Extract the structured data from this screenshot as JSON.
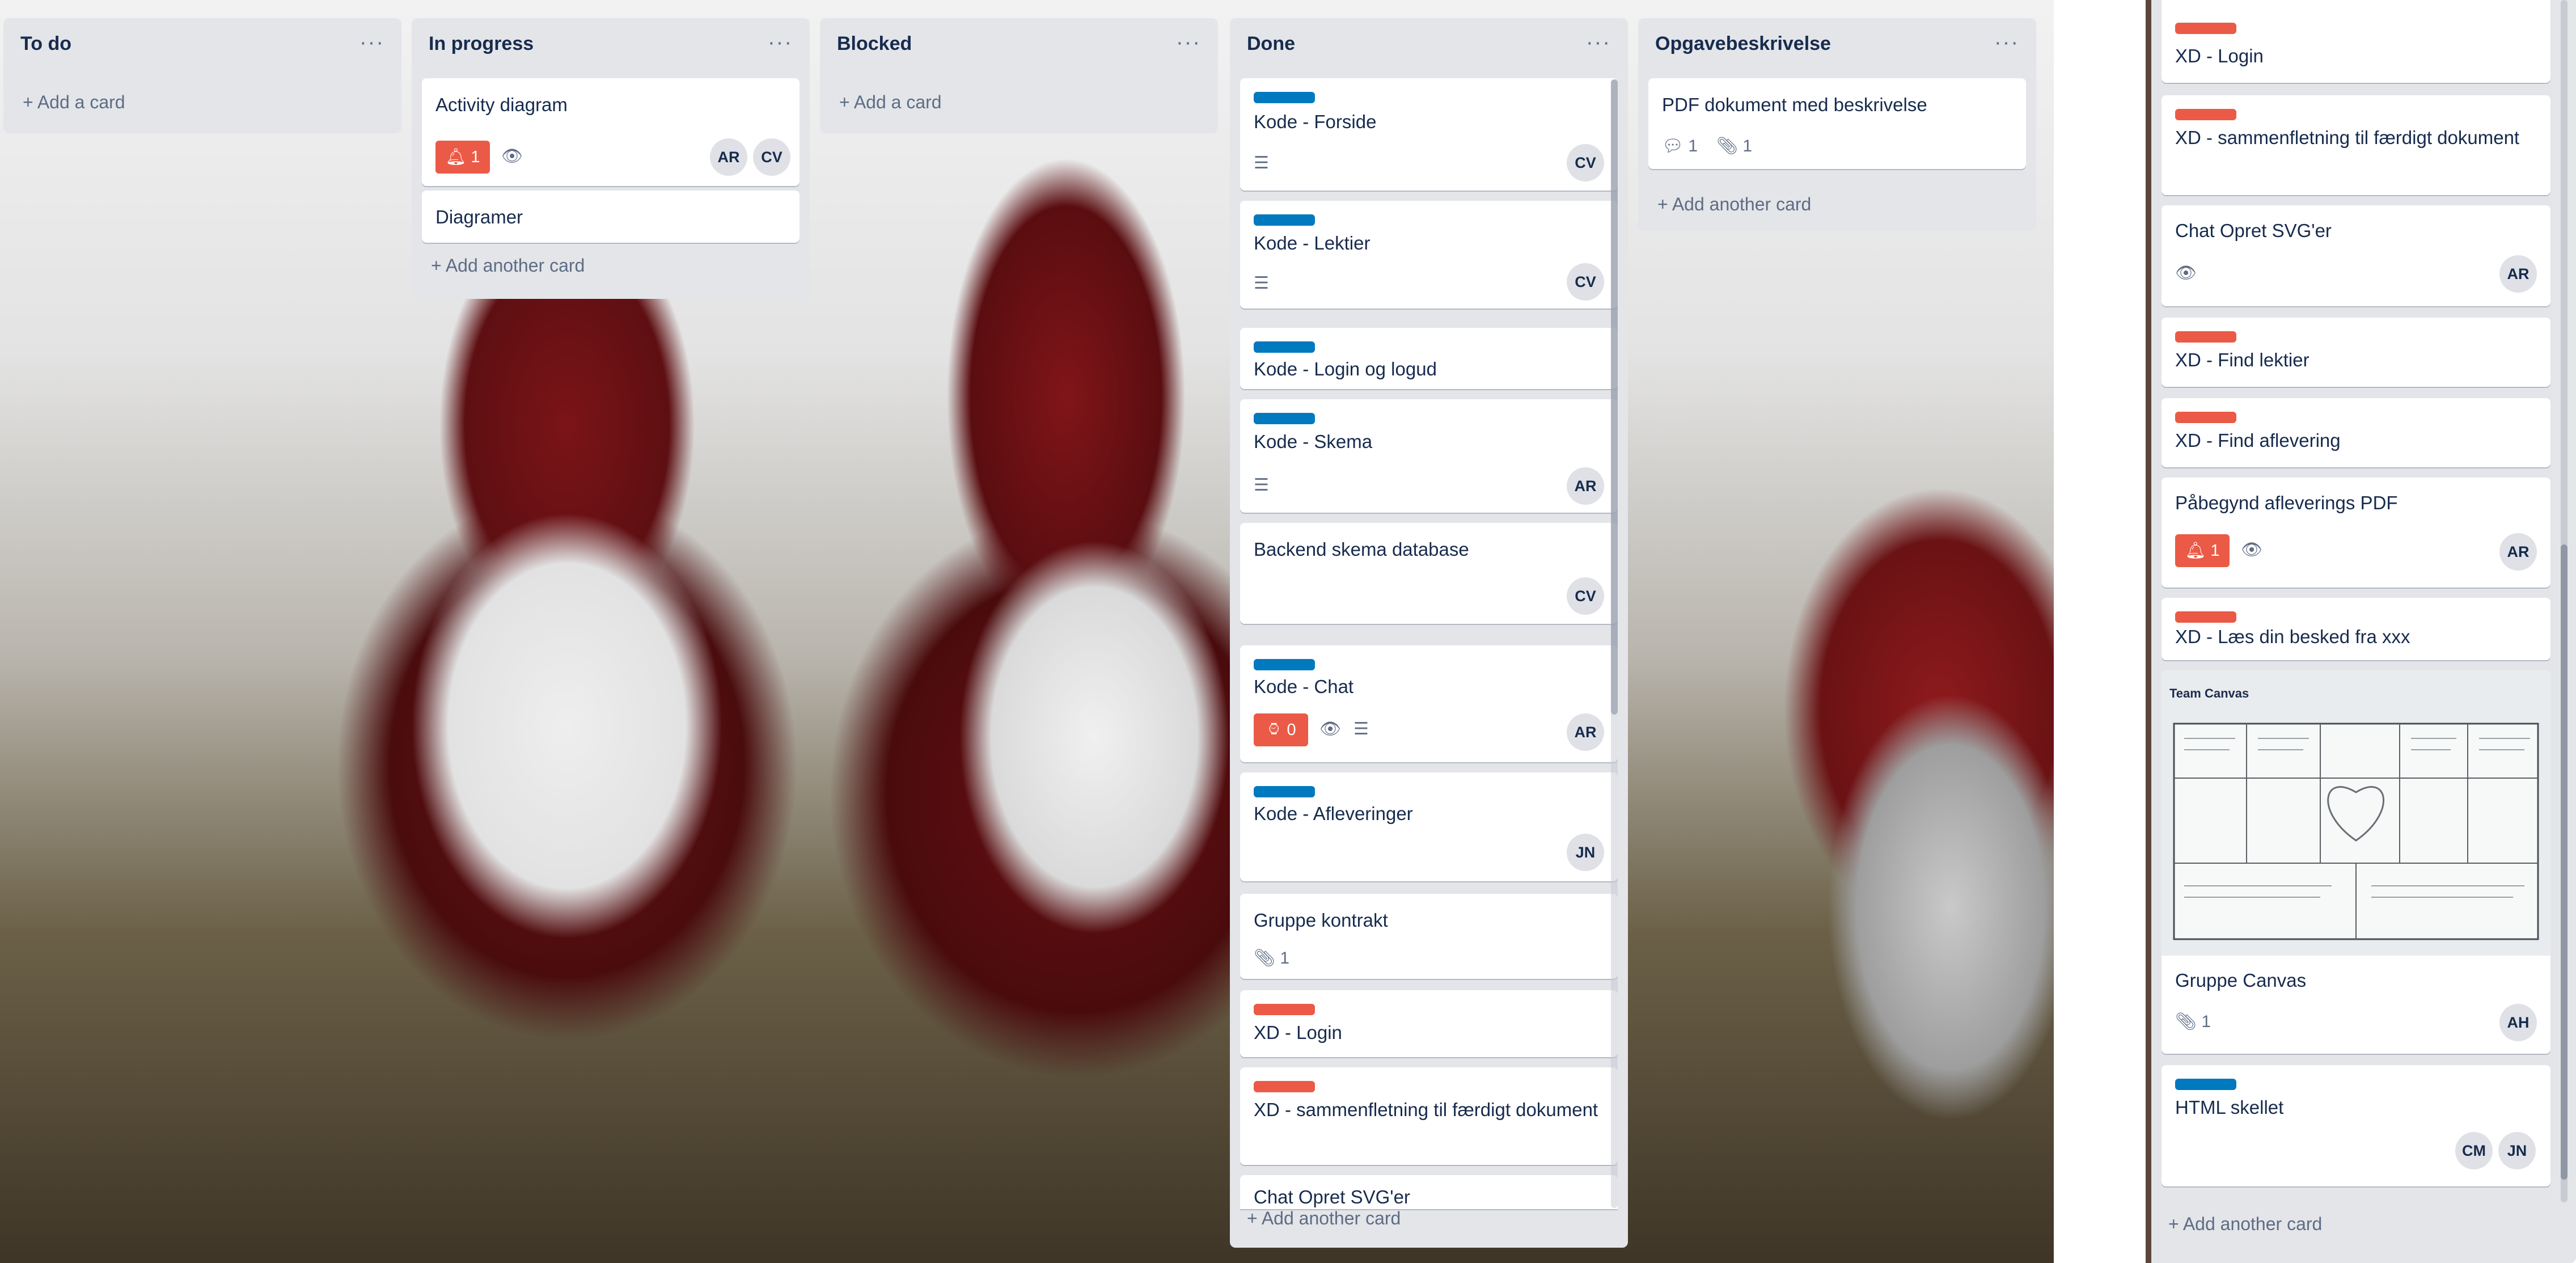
{
  "board": {
    "lists": [
      {
        "title": "To do",
        "menu": "···",
        "add": "+ Add a card"
      },
      {
        "title": "In progress",
        "menu": "···",
        "cards": [
          {
            "title": "Activity diagram",
            "due": "1",
            "avatars": [
              "AR",
              "CV"
            ]
          },
          {
            "title": "Diagramer"
          }
        ],
        "add": "+ Add another card"
      },
      {
        "title": "Blocked",
        "menu": "···",
        "add": "+ Add a card"
      },
      {
        "title": "Done",
        "menu": "···",
        "cards": [
          {
            "title": "Kode - Forside",
            "avatar": "CV"
          },
          {
            "title": "Kode - Lektier",
            "avatar": "CV"
          },
          {
            "title": "Kode - Login og logud"
          },
          {
            "title": "Kode - Skema",
            "avatar": "AR"
          },
          {
            "title": "Backend skema database",
            "avatar": "CV"
          },
          {
            "title": "Kode - Chat",
            "due": "0",
            "avatar": "AR"
          },
          {
            "title": "Kode - Afleveringer",
            "avatar": "JN"
          },
          {
            "title": "Gruppe kontrakt",
            "attachments": "1"
          },
          {
            "title": "XD - Login"
          },
          {
            "title": "XD - sammenfletning til færdigt dokument"
          },
          {
            "title": "Chat Opret SVG'er"
          }
        ],
        "add": "+ Add another card"
      },
      {
        "title": "Opgavebeskrivelse",
        "menu": "···",
        "cards": [
          {
            "title": "PDF dokument med beskrivelse",
            "comments": "1",
            "attachments": "1"
          }
        ],
        "add": "+ Add another card"
      }
    ]
  },
  "zoom": {
    "cards": [
      {
        "title": "XD - Login"
      },
      {
        "title": "XD - sammenfletning til færdigt dokument"
      },
      {
        "title": "Chat Opret SVG'er",
        "avatar": "AR"
      },
      {
        "title": "XD - Find lektier"
      },
      {
        "title": "XD - Find aflevering"
      },
      {
        "title": "Påbegynd afleverings PDF",
        "due": "1",
        "avatar": "AR"
      },
      {
        "title": "XD - Læs din besked fra xxx"
      },
      {
        "title": "Gruppe Canvas",
        "attachments": "1",
        "avatar": "AH",
        "preview_caption": "Team Canvas"
      },
      {
        "title": "HTML skellet",
        "avatars": [
          "CM",
          "JN"
        ]
      }
    ],
    "add": "+ Add another card"
  },
  "colors": {
    "list_bg": "#e3e5e9",
    "label_red": "#eb5a46",
    "label_blue": "#0079bf",
    "text": "#172b4d",
    "muted": "#5e6c84"
  }
}
